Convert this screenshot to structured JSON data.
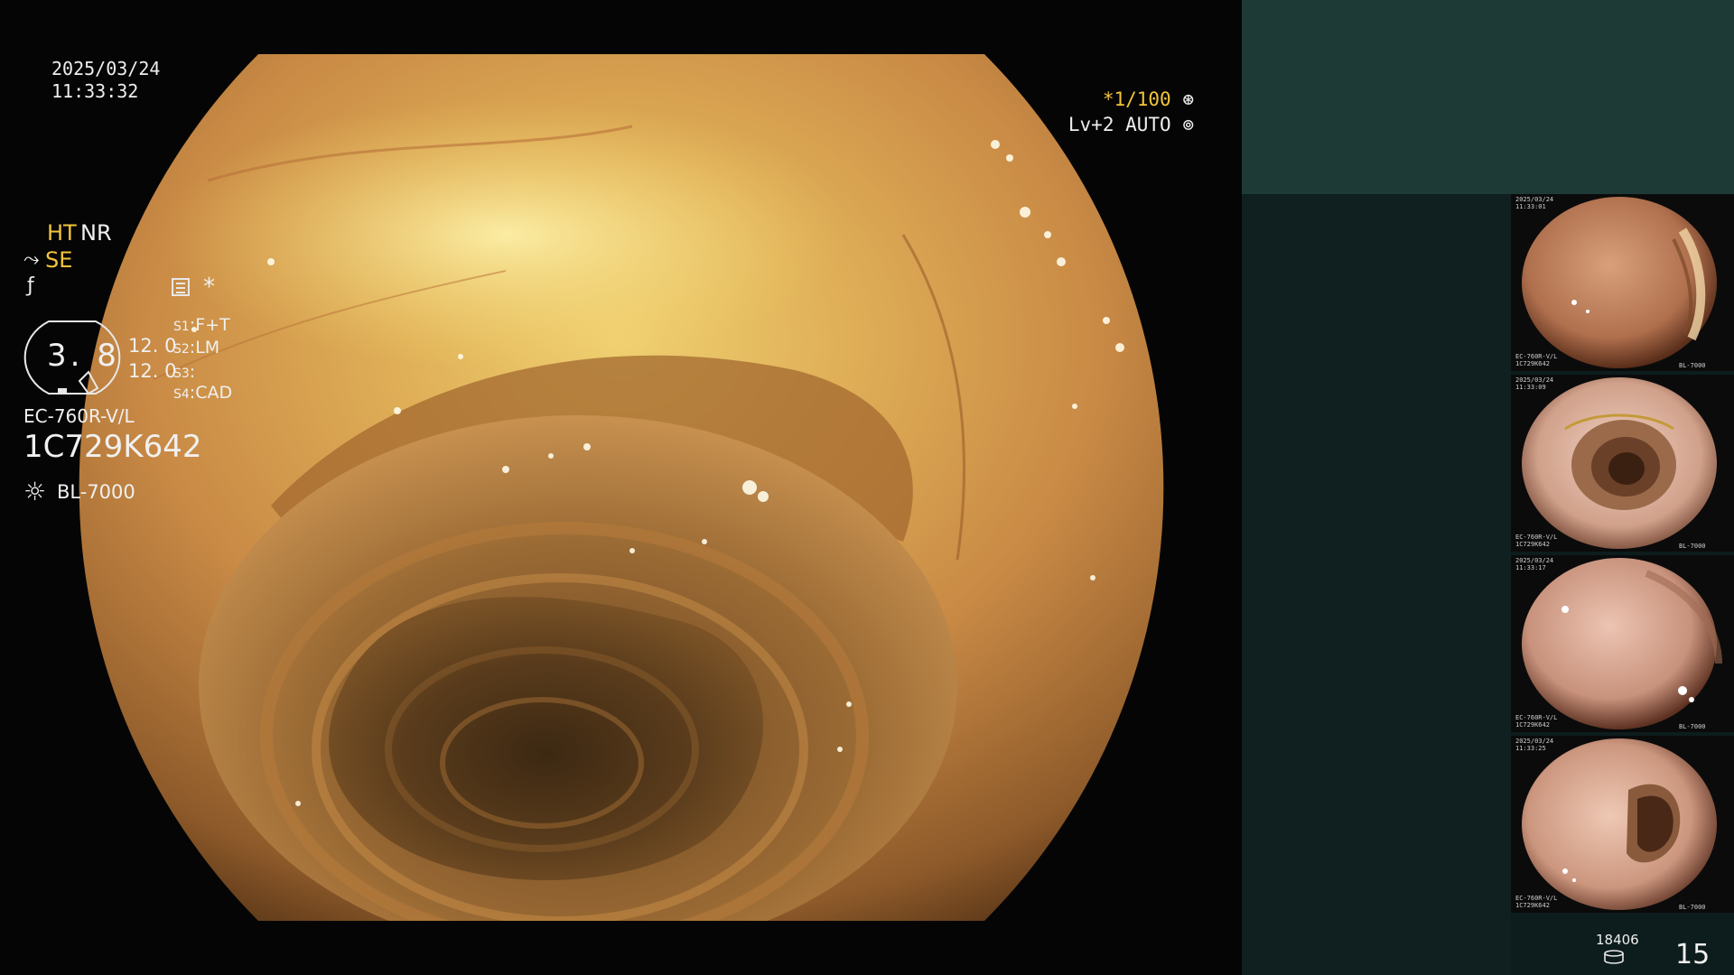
{
  "overlay": {
    "date": "2025/03/24",
    "time": "11:33:32",
    "shutter": "*1/100",
    "shutter_icon": "aperture-icon",
    "level": "Lv+2 AUTO",
    "auto_icon": "auto-iris-icon"
  },
  "panel": {
    "ht": "HT",
    "nr": "NR",
    "se": "SE",
    "memo_symbol": "*",
    "gauge_value": "3. 8",
    "gain_1": "12. 0",
    "gain_2": "12. 0",
    "switches": [
      {
        "key": "S1",
        "value": "F+T"
      },
      {
        "key": "S2",
        "value": "LM"
      },
      {
        "key": "S3",
        "value": ""
      },
      {
        "key": "S4",
        "value": "CAD"
      }
    ],
    "scope_model": "EC-760R-V/L",
    "scope_serial": "1C729K642",
    "light_source": "BL-7000",
    "image_count": "18406",
    "captured_count": "15"
  },
  "colors": {
    "panel_top": "#1e3a37",
    "panel_body": "#101f1f",
    "highlight": "#f3c53a",
    "mucosa": "#c98a45"
  },
  "thumbnails": [
    {
      "date": "2025/03/24",
      "time": "11:33:01",
      "model": "EC-760R-V/L",
      "serial": "1C729K642",
      "light": "BL-7000"
    },
    {
      "date": "2025/03/24",
      "time": "11:33:09",
      "model": "EC-760R-V/L",
      "serial": "1C729K642",
      "light": "BL-7000"
    },
    {
      "date": "2025/03/24",
      "time": "11:33:17",
      "model": "EC-760R-V/L",
      "serial": "1C729K642",
      "light": "BL-7000"
    },
    {
      "date": "2025/03/24",
      "time": "11:33:25",
      "model": "EC-760R-V/L",
      "serial": "1C729K642",
      "light": "BL-7000"
    }
  ]
}
